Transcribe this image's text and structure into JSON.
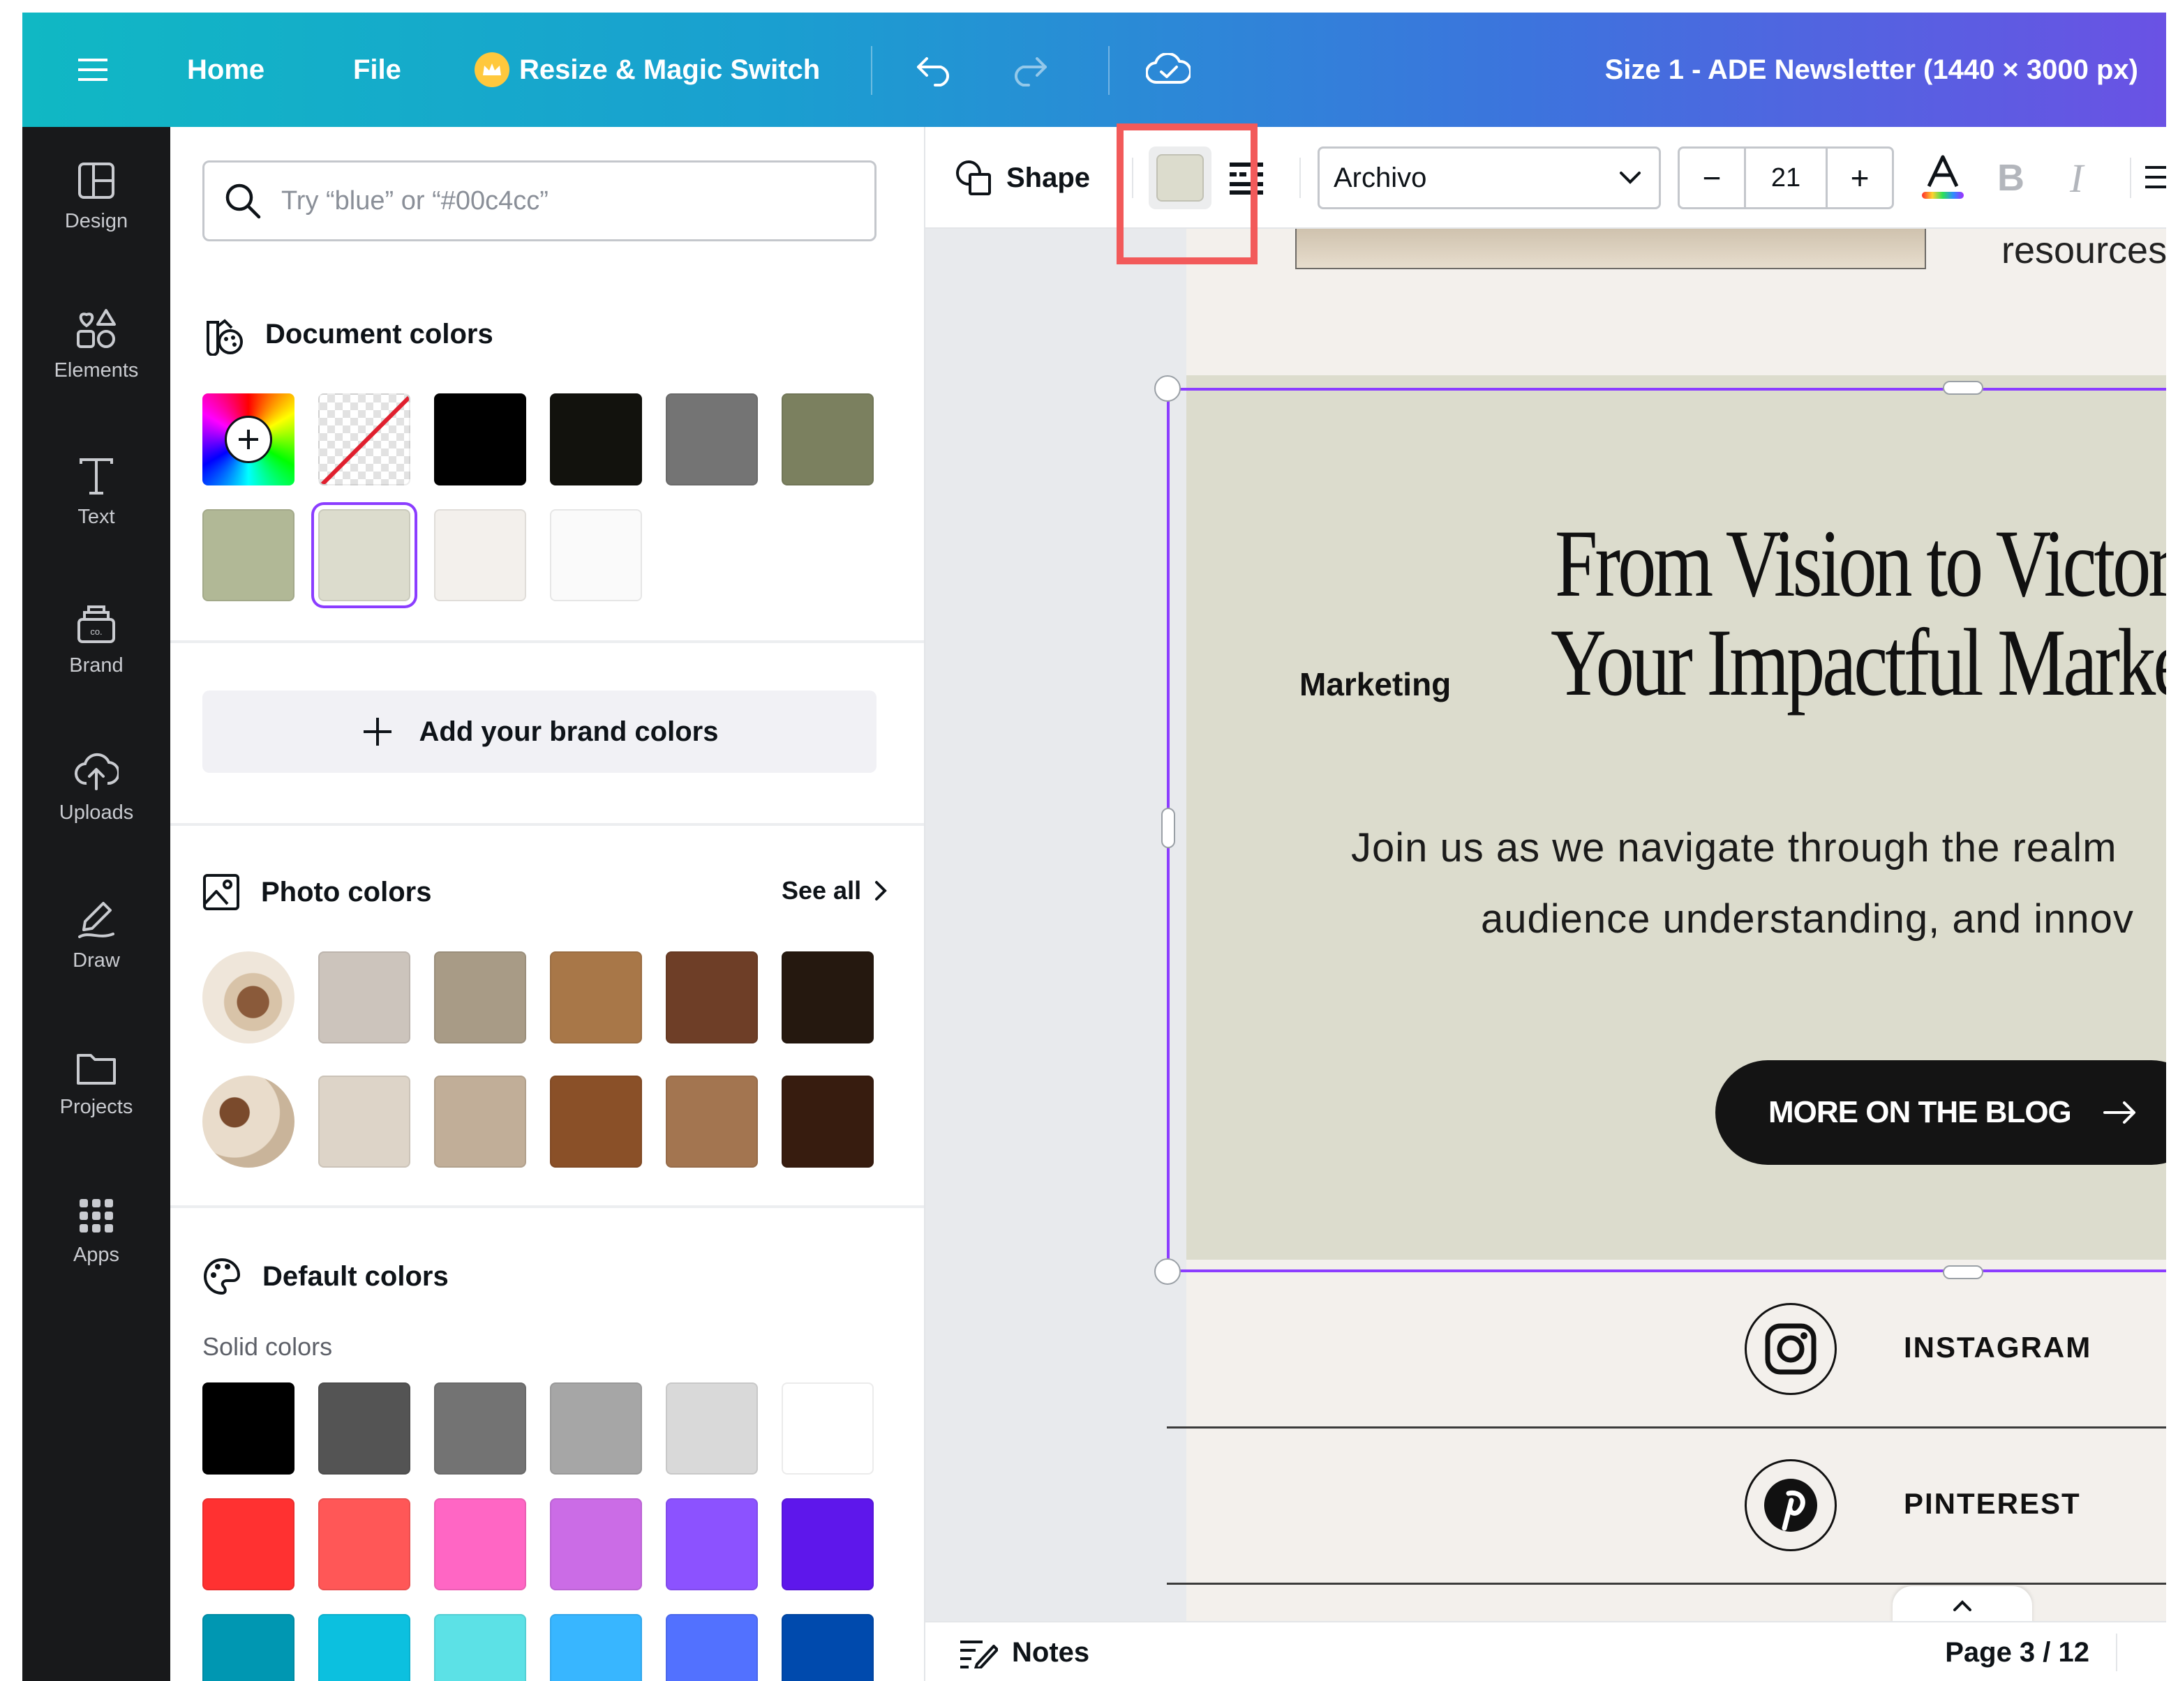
{
  "topbar": {
    "home": "Home",
    "file": "File",
    "resize": "Resize & Magic Switch",
    "title": "Size 1 - ADE Newsletter (1440 × 3000 px)"
  },
  "rail": {
    "items": [
      {
        "label": "Design",
        "icon": "design-icon"
      },
      {
        "label": "Elements",
        "icon": "elements-icon"
      },
      {
        "label": "Text",
        "icon": "text-icon"
      },
      {
        "label": "Brand",
        "icon": "brand-icon"
      },
      {
        "label": "Uploads",
        "icon": "uploads-icon"
      },
      {
        "label": "Draw",
        "icon": "draw-icon"
      },
      {
        "label": "Projects",
        "icon": "projects-icon"
      },
      {
        "label": "Apps",
        "icon": "apps-icon"
      }
    ]
  },
  "panel": {
    "search_placeholder": "Try “blue” or “#00c4cc”",
    "document_colors_title": "Document colors",
    "document_colors": [
      "#000000",
      "#12120d",
      "#747474",
      "#7b805f",
      "#b1b896",
      "#dcdccd",
      "#f3f0ec",
      "#fafafa"
    ],
    "selected_color": "#dcdccd",
    "add_brand_colors": "Add your brand colors",
    "photo_colors_title": "Photo colors",
    "see_all": "See all",
    "photo_colors_row1": [
      "#ccc4bc",
      "#a89b86",
      "#a87748",
      "#6e3e27",
      "#25180f"
    ],
    "photo_colors_row2": [
      "#ddd4c8",
      "#c1ae98",
      "#8a5028",
      "#a37550",
      "#371c0f"
    ],
    "default_colors_title": "Default colors",
    "solid_colors_label": "Solid colors",
    "default_row1": [
      "#000000",
      "#545454",
      "#737373",
      "#a6a6a6",
      "#d9d9d9",
      "#ffffff"
    ],
    "default_row2": [
      "#ff3131",
      "#ff5757",
      "#ff66c4",
      "#cb6ce6",
      "#8c52ff",
      "#5e17eb"
    ],
    "default_row3": [
      "#0097b2",
      "#0cc0df",
      "#5ce1e6",
      "#38b6ff",
      "#5271ff",
      "#004aad"
    ]
  },
  "toolbar": {
    "shape": "Shape",
    "font": "Archivo",
    "font_size": "21",
    "bold": "B",
    "italic": "I"
  },
  "canvas": {
    "resources_text": "resources",
    "marketing": "Marketing",
    "headline_1": "From Vision to Victory",
    "headline_2": "Your Impactful Marketing",
    "body_1": "Join us as we navigate through the realm",
    "body_2": "audience understanding, and innov",
    "blog_button": "MORE ON THE BLOG",
    "instagram": "INSTAGRAM",
    "pinterest": "PINTEREST"
  },
  "bottom": {
    "notes": "Notes",
    "page": "Page 3 / 12"
  },
  "colors": {
    "accent_selection": "#8b3dff",
    "highlight_box": "#f25a5a",
    "card_bg": "#dcdccd",
    "page_bg": "#f3f0ec"
  }
}
